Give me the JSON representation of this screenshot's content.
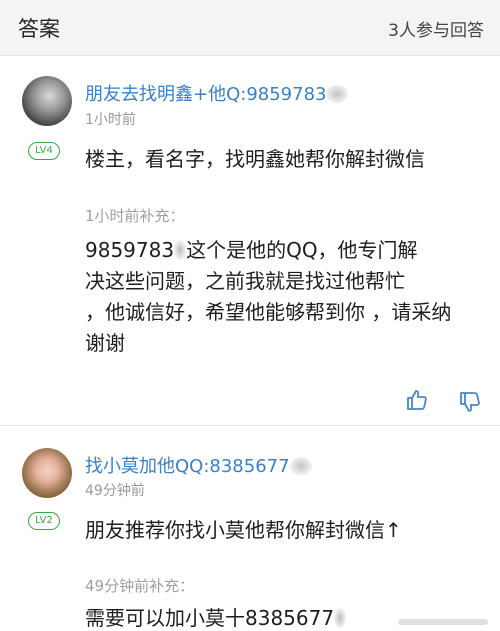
{
  "header": {
    "title": "答案",
    "participants": "3人参与回答"
  },
  "answers": [
    {
      "username": "朋友去找明鑫+他Q:9859783",
      "time": "1小时前",
      "level": "LV4",
      "content": "楼主，看名字，找明鑫她帮你解封微信",
      "supplement_label": "1小时前补充：",
      "supplement_lines": [
        "9859783",
        "这个是他的QQ，他专门解",
        "决这些问题，之前我就是找过他帮忙",
        "，他诚信好，希望他能够帮到你 ，请采纳",
        "谢谢"
      ]
    },
    {
      "username": "找小莫加他QQ:8385677",
      "time": "49分钟前",
      "level": "LV2",
      "content": "朋友推荐你找小莫他帮你解封微信↑",
      "supplement_label": "49分钟前补充：",
      "supplement_lines": [
        "需要可以加小莫十8385677"
      ]
    }
  ],
  "icons": {
    "like": "thumbs-up-icon",
    "dislike": "thumbs-down-icon"
  },
  "colors": {
    "username": "#3d7fc1",
    "level_badge": "#3aa64a",
    "timestamp": "#9a9a9a",
    "icon": "#4a86c5"
  }
}
